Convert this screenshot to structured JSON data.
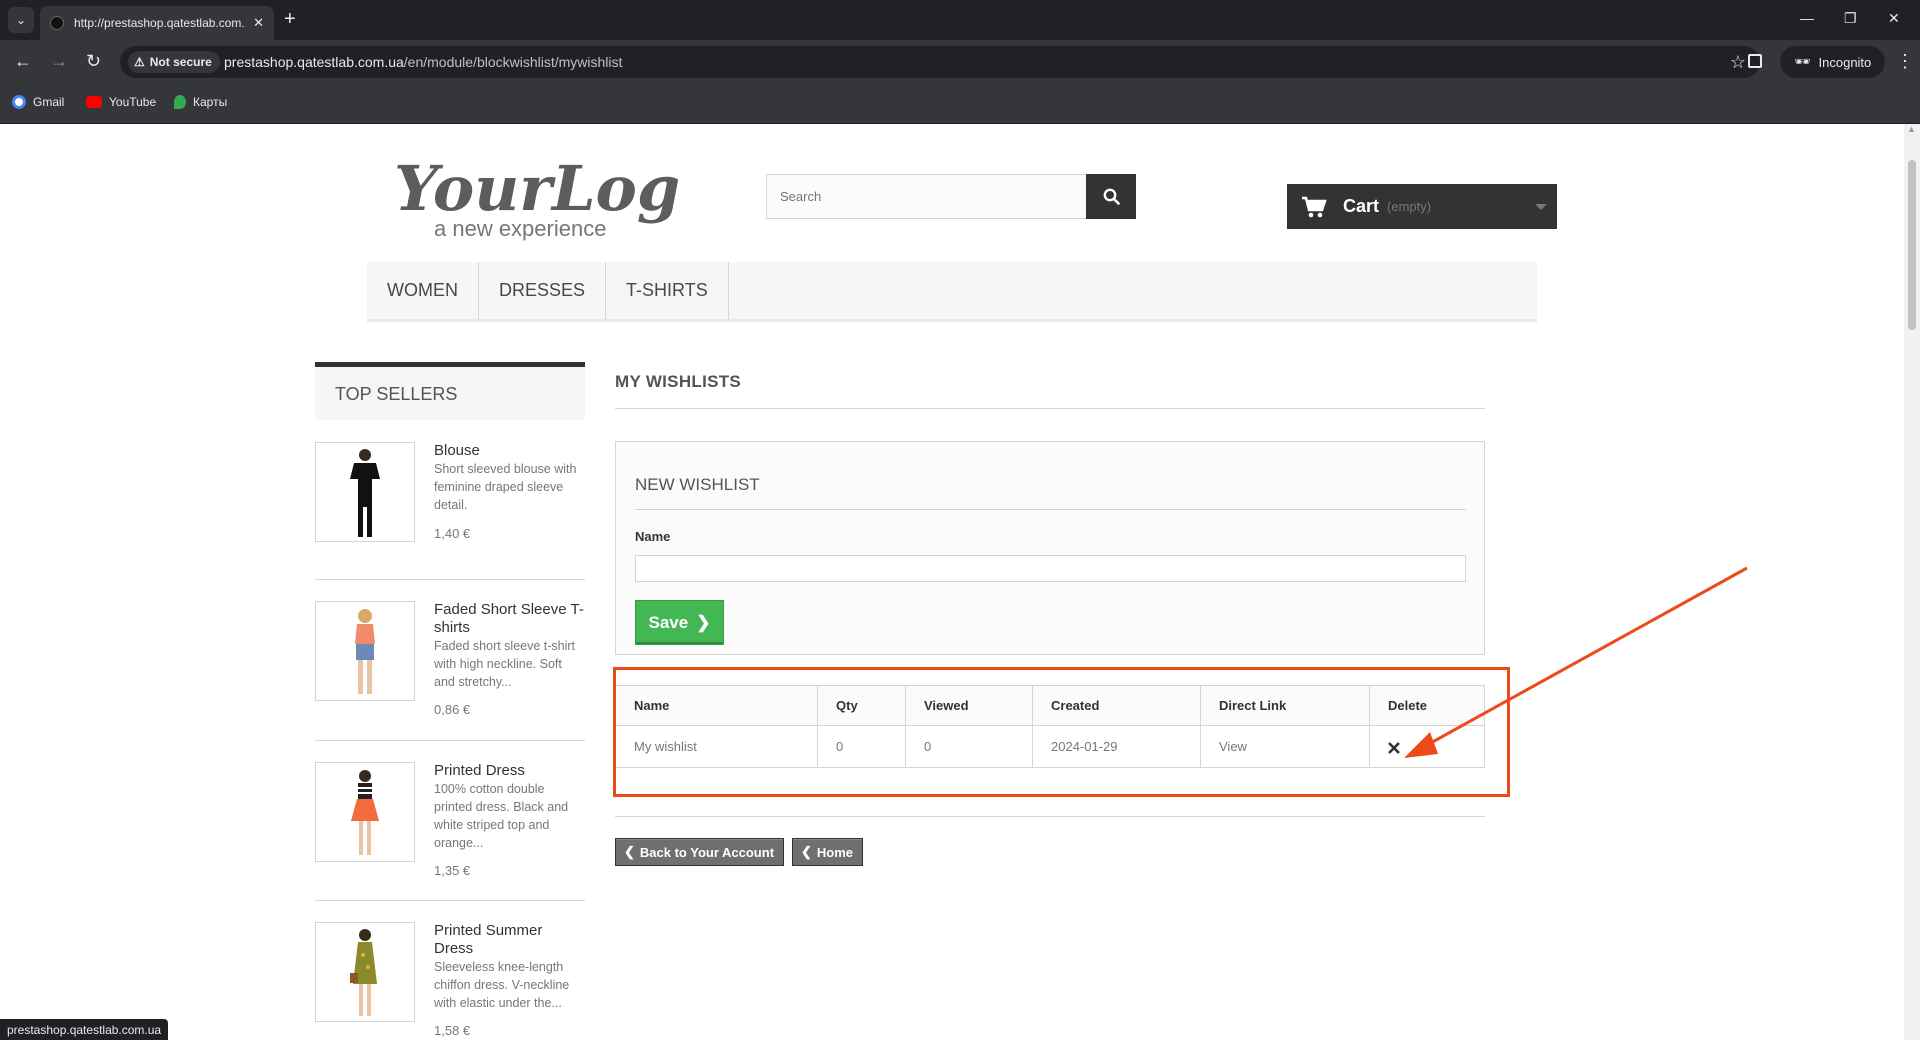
{
  "browser": {
    "tab_title": "http://prestashop.qatestlab.com.ua/en/module/blockwishlist/mywishlist",
    "security_label": "Not secure",
    "url_host": "prestashop.qatestlab.com.ua",
    "url_path": "/en/module/blockwishlist/mywishlist",
    "profile_label": "Incognito",
    "bookmarks": [
      {
        "label": "Gmail",
        "icon": "google-icon"
      },
      {
        "label": "YouTube",
        "icon": "youtube-icon"
      },
      {
        "label": "Карты",
        "icon": "maps-icon"
      }
    ],
    "status_url": "prestashop.qatestlab.com.ua"
  },
  "header": {
    "logo_text": "YourLogo",
    "logo_tagline": "a new experience",
    "search_placeholder": "Search",
    "cart_label": "Cart",
    "cart_status": "(empty)"
  },
  "menu": {
    "items": [
      {
        "label": "Women"
      },
      {
        "label": "Dresses"
      },
      {
        "label": "T-shirts"
      }
    ]
  },
  "top_sellers": {
    "title": "Top sellers",
    "products": [
      {
        "name": "Blouse",
        "description": "Short sleeved blouse with feminine draped sleeve detail.",
        "price": "1,40 €"
      },
      {
        "name": "Faded Short Sleeve T-shirts",
        "description": "Faded short sleeve t-shirt with high neckline. Soft and stretchy...",
        "price": "0,86 €"
      },
      {
        "name": "Printed Dress",
        "description": "100% cotton double printed dress. Black and white striped top and orange...",
        "price": "1,35 €"
      },
      {
        "name": "Printed Summer Dress",
        "description": "Sleeveless knee-length chiffon dress. V-neckline with elastic under the...",
        "price": "1,58 €"
      }
    ]
  },
  "wishlist": {
    "page_title": "My wishlists",
    "form_title": "New wishlist",
    "name_label": "Name",
    "name_value": "",
    "save_label": "Save",
    "table": {
      "headers": [
        "Name",
        "Qty",
        "Viewed",
        "Created",
        "Direct Link",
        "Delete"
      ],
      "rows": [
        {
          "name": "My wishlist",
          "qty": "0",
          "viewed": "0",
          "created": "2024-01-29",
          "link": "View"
        }
      ]
    },
    "back_label": "Back to Your Account",
    "home_label": "Home"
  },
  "colors": {
    "annotation": "#ed4a1a",
    "save_green": "#43b754",
    "dark": "#333333"
  }
}
